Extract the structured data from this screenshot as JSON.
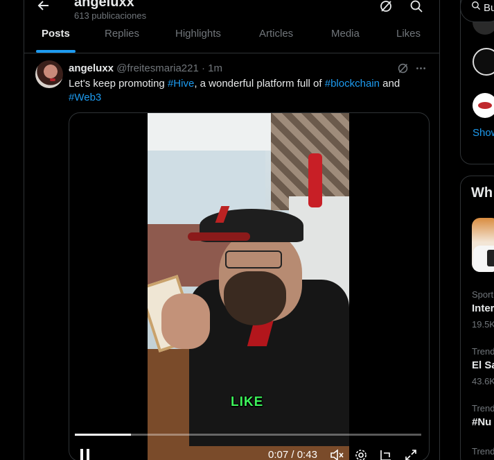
{
  "header": {
    "title": "angeluxx",
    "subtitle": "613 publicaciones"
  },
  "tabs": [
    {
      "label": "Posts",
      "active": true
    },
    {
      "label": "Replies",
      "active": false
    },
    {
      "label": "Highlights",
      "active": false
    },
    {
      "label": "Articles",
      "active": false
    },
    {
      "label": "Media",
      "active": false
    },
    {
      "label": "Likes",
      "active": false
    }
  ],
  "post": {
    "author": "angeluxx",
    "handle": "@freitesmaria221",
    "separator": "·",
    "time": "1m",
    "text_1": "Let's keep promoting ",
    "tag_1": "#Hive",
    "text_2": ", a wonderful platform full of ",
    "tag_2": "#blockchain",
    "text_3": " and",
    "tag_3": "#Web3"
  },
  "video": {
    "caption": "LIKE",
    "current_time": "0:07",
    "duration": "0:43",
    "time_separator": " / ",
    "progress": 0.163,
    "state": "playing"
  },
  "sidebar": {
    "search_text": "Bu",
    "show_more": "Show",
    "whats_happening": "Wh",
    "trends": [
      {
        "category": "Sport",
        "name": "Inter",
        "count": "19.5K"
      },
      {
        "category": "Trend",
        "name": "El Sa",
        "count": "43.6K"
      },
      {
        "category": "Trend",
        "name": "#Nu",
        "count": ""
      },
      {
        "category": "Trend",
        "name": "",
        "count": ""
      }
    ]
  },
  "colors": {
    "accent": "#1d9bf0",
    "background": "#000000",
    "border": "#2f3336",
    "muted_text": "#71767b",
    "caption_green": "#3df25a"
  },
  "icons": [
    "back-arrow-icon",
    "grok-icon",
    "search-icon",
    "more-icon",
    "pause-icon",
    "mute-icon",
    "settings-icon",
    "pip-icon",
    "fullscreen-icon"
  ]
}
